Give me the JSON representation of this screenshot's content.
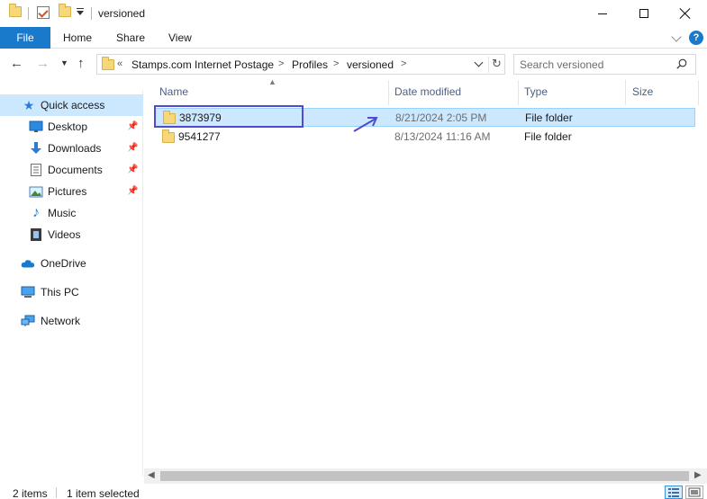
{
  "window": {
    "title": "versioned",
    "controls": {
      "minimize": "minimize",
      "maximize": "maximize",
      "close": "close"
    }
  },
  "ribbon": {
    "tabs": [
      {
        "label": "File",
        "active": true
      },
      {
        "label": "Home"
      },
      {
        "label": "Share"
      },
      {
        "label": "View"
      }
    ],
    "help": "?"
  },
  "address": {
    "overflow": "«",
    "crumbs": [
      "Stamps.com Internet Postage",
      "Profiles",
      "versioned"
    ],
    "separator": ">"
  },
  "search": {
    "placeholder": "Search versioned",
    "value": ""
  },
  "sidebar": {
    "items": [
      {
        "label": "Quick access",
        "icon": "star-icon",
        "selected": true
      },
      {
        "label": "Desktop",
        "icon": "desktop-icon",
        "pinned": true
      },
      {
        "label": "Downloads",
        "icon": "download-icon",
        "pinned": true
      },
      {
        "label": "Documents",
        "icon": "documents-icon",
        "pinned": true
      },
      {
        "label": "Pictures",
        "icon": "pictures-icon",
        "pinned": true
      },
      {
        "label": "Music",
        "icon": "music-icon"
      },
      {
        "label": "Videos",
        "icon": "videos-icon"
      },
      {
        "label": "OneDrive",
        "icon": "cloud-icon"
      },
      {
        "label": "This PC",
        "icon": "computer-icon"
      },
      {
        "label": "Network",
        "icon": "network-icon"
      }
    ]
  },
  "list": {
    "columns": [
      "Name",
      "Date modified",
      "Type",
      "Size"
    ],
    "rows": [
      {
        "name": "3873979",
        "date": "8/21/2024 2:05 PM",
        "type": "File folder",
        "selected": true
      },
      {
        "name": "9541277",
        "date": "8/13/2024 11:16 AM",
        "type": "File folder",
        "selected": false
      }
    ]
  },
  "status": {
    "count": "2 items",
    "selection": "1 item selected"
  },
  "colors": {
    "accent": "#1979ca",
    "selection": "#cce8ff",
    "annotation": "#5049d1",
    "folder": "#f6d87a"
  }
}
